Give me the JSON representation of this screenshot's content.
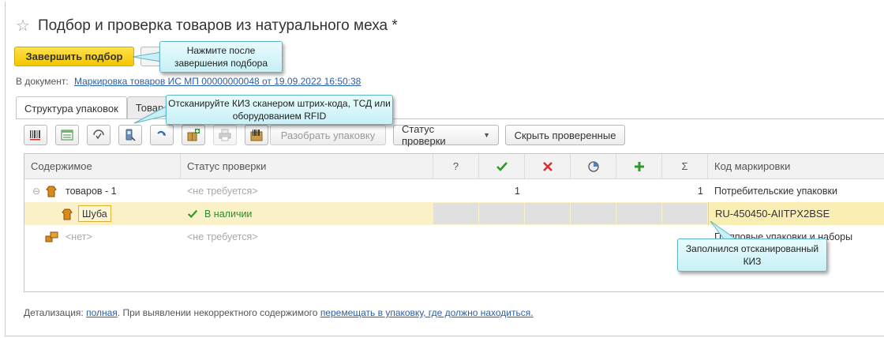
{
  "window": {
    "title": "Подбор и проверка товаров из натурального меха *",
    "star_icon": "☆"
  },
  "actions": {
    "finish_label": "Завершить подбор"
  },
  "document": {
    "prefix": "В документ:",
    "link": "Маркировка товаров ИС МП 00000000048 от 19.09.2022 16:50:38"
  },
  "tabs": [
    {
      "label": "Структура упаковок",
      "active": true
    },
    {
      "label": "Товар",
      "active": false
    }
  ],
  "toolbar": {
    "unpack_label": "Разобрать упаковку",
    "status_label": "Статус проверки",
    "hide_checked_label": "Скрыть проверенные"
  },
  "grid": {
    "columns": {
      "content": "Содержимое",
      "status": "Статус проверки",
      "question": "?",
      "sum": "Σ",
      "code": "Код маркировки"
    },
    "rows": [
      {
        "expand": "⊖",
        "content": "товаров - 1",
        "status": "<не требуется>",
        "ok_count": "1",
        "total": "1",
        "code": "Потребительские упаковки"
      },
      {
        "content": "Шуба",
        "status": "В наличии",
        "code": "RU-450450-AIITPX2BSE"
      },
      {
        "content": "<нет>",
        "status": "<не требуется>",
        "code": "Групповые упаковки и наборы"
      }
    ]
  },
  "footer": {
    "prefix": "Детализация:",
    "detail_link": "полная",
    "middle": ". При выявлении некорректного содержимого",
    "move_link": "перемещать в упаковку, где должно находиться."
  },
  "callouts": {
    "finish": "Нажмите после завершения подбора",
    "scan": "Отсканируйте КИЗ сканером штрих-кода, ТСД или оборудованием RFID",
    "filled": "Заполнился отсканированный КИЗ"
  },
  "colors": {
    "accent_yellow": "#f3c600",
    "link_blue": "#2b5fa6",
    "green_check": "#2e8b2e",
    "red_cross": "#d83030",
    "callout_bg": "#c8f0f6"
  }
}
